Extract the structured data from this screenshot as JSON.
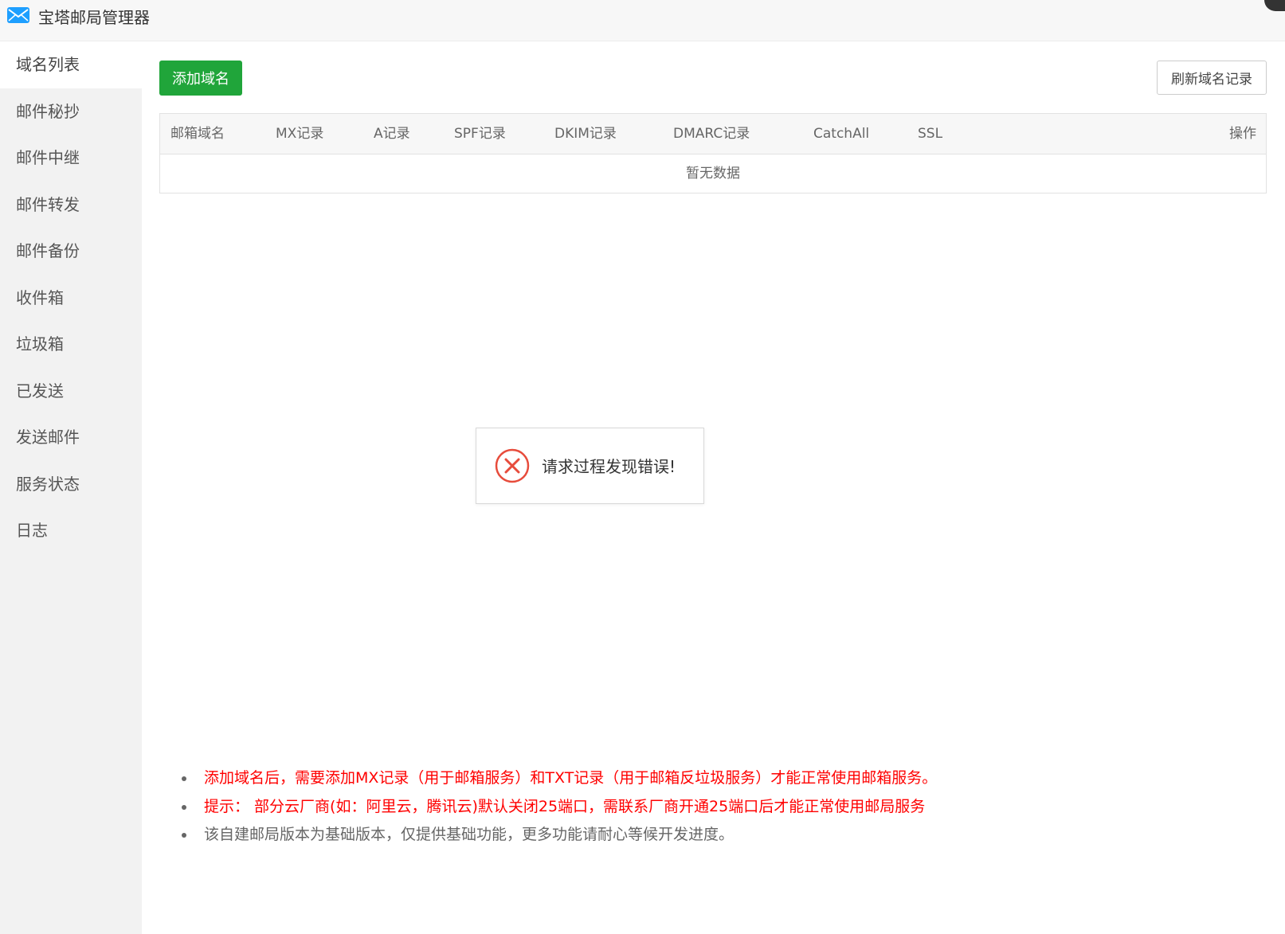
{
  "app": {
    "title": "宝塔邮局管理器",
    "icon": "envelope-icon"
  },
  "sidebar": {
    "items": [
      {
        "label": "域名列表",
        "active": true
      },
      {
        "label": "邮件秘抄",
        "active": false
      },
      {
        "label": "邮件中继",
        "active": false
      },
      {
        "label": "邮件转发",
        "active": false
      },
      {
        "label": "邮件备份",
        "active": false
      },
      {
        "label": "收件箱",
        "active": false
      },
      {
        "label": "垃圾箱",
        "active": false
      },
      {
        "label": "已发送",
        "active": false
      },
      {
        "label": "发送邮件",
        "active": false
      },
      {
        "label": "服务状态",
        "active": false
      },
      {
        "label": "日志",
        "active": false
      }
    ]
  },
  "toolbar": {
    "add_label": "添加域名",
    "refresh_label": "刷新域名记录"
  },
  "table": {
    "columns": [
      "邮箱域名",
      "MX记录",
      "A记录",
      "SPF记录",
      "DKIM记录",
      "DMARC记录",
      "CatchAll",
      "SSL",
      "操作"
    ],
    "empty_text": "暂无数据"
  },
  "toast": {
    "message": "请求过程发现错误!",
    "icon": "error-circle-icon"
  },
  "tips": [
    "添加域名后，需要添加MX记录（用于邮箱服务）和TXT记录（用于邮箱反垃圾服务）才能正常使用邮箱服务。",
    "提示： 部分云厂商(如：阿里云，腾讯云)默认关闭25端口，需联系厂商开通25端口后才能正常使用邮局服务",
    "该自建邮局版本为基础版本，仅提供基础功能，更多功能请耐心等候开发进度。"
  ],
  "colors": {
    "primary_button": "#20a53a",
    "warning_text": "#ff0000",
    "error_icon": "#e74c3c",
    "sidebar_bg": "#f2f2f2",
    "app_icon": "#1e9fff"
  }
}
